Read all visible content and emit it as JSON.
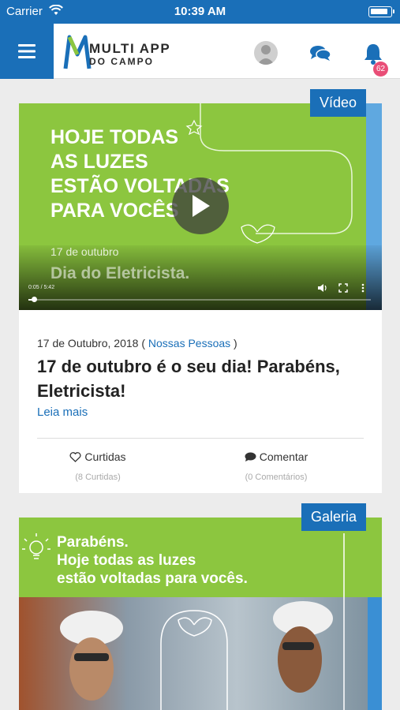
{
  "status_bar": {
    "carrier": "Carrier",
    "time": "10:39 AM"
  },
  "header": {
    "logo_line1": "MULTI APP",
    "logo_line2": "DO CAMPO",
    "notification_count": "62",
    "icons": [
      "menu-icon",
      "avatar-icon",
      "chat-icon",
      "bell-icon"
    ]
  },
  "posts": [
    {
      "type_label": "Vídeo",
      "media": {
        "headline": "HOJE TODAS\nAS LUZES\nESTÃO VOLTADAS\nPARA VOCÊS",
        "date": "17 de outubro",
        "subtitle": "Dia do Eletricista.",
        "time_display": "0:05 / 5:42",
        "progress": 0.015
      },
      "date": "17 de Outubro, 2018",
      "category": "Nossas Pessoas",
      "title": "17 de outubro é o seu dia! Parabéns, Eletricista!",
      "read_more": "Leia mais",
      "like_label": "Curtidas",
      "like_count": "(8 Curtidas)",
      "comment_label": "Comentar",
      "comment_count": "(0 Comentários)"
    },
    {
      "type_label": "Galeria",
      "media": {
        "text": "Parabéns.\nHoje todas as luzes\nestão voltadas para vocês."
      }
    }
  ],
  "colors": {
    "brand_blue": "#1a6fb8",
    "accent_green": "#8cc63f",
    "badge_pink": "#e94e77"
  }
}
